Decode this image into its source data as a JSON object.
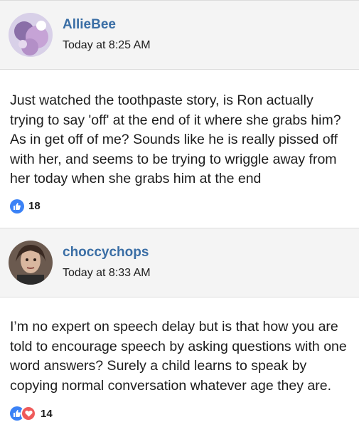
{
  "posts": [
    {
      "username": "AllieBee",
      "timestamp": "Today at 8:25 AM",
      "body": "Just watched the toothpaste story, is Ron actually trying to say 'off' at the end of it where she grabs him? As in get off of me? Sounds like he is really pissed off with her, and seems to be trying to wriggle away from her today when she grabs him at the end",
      "reactions": [
        "like-icon"
      ],
      "reaction_count": "18"
    },
    {
      "username": "choccychops",
      "timestamp": "Today at 8:33 AM",
      "body": "I’m no expert on speech delay but is that how you are told to encourage speech by asking questions with one word answers? Surely a child learns to speak by copying normal conversation whatever age they are.",
      "reactions": [
        "like-icon",
        "love-icon"
      ],
      "reaction_count": "14"
    }
  ],
  "colors": {
    "username": "#3a6ea5",
    "header_bg": "#f4f4f4",
    "like": "#3b82f6",
    "love": "#ef5a5a"
  }
}
